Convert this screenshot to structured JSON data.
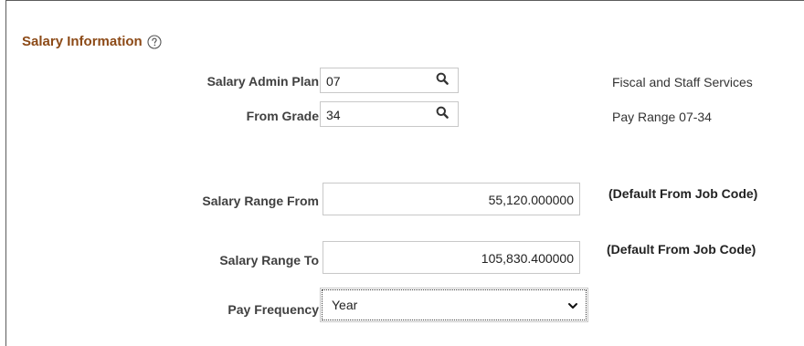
{
  "section": {
    "title": "Salary Information",
    "help_icon": "help-circle-icon"
  },
  "salary_admin_plan": {
    "label": "Salary Admin Plan",
    "value": "07",
    "lookup_icon": "search-icon",
    "description": "Fiscal and Staff Services"
  },
  "from_grade": {
    "label": "From Grade",
    "value": "34",
    "lookup_icon": "search-icon",
    "description": "Pay Range 07-34"
  },
  "salary_range_from": {
    "label": "Salary Range From",
    "value": "55,120.000000",
    "note": "(Default From Job Code)"
  },
  "salary_range_to": {
    "label": "Salary Range To",
    "value": "105,830.400000",
    "note": "(Default From Job Code)"
  },
  "pay_frequency": {
    "label": "Pay Frequency",
    "selected": "Year",
    "chevron_icon": "chevron-down-icon"
  },
  "colors": {
    "section_title": "#8c4a17",
    "label": "#404040",
    "input_border": "#c8c8c8"
  }
}
